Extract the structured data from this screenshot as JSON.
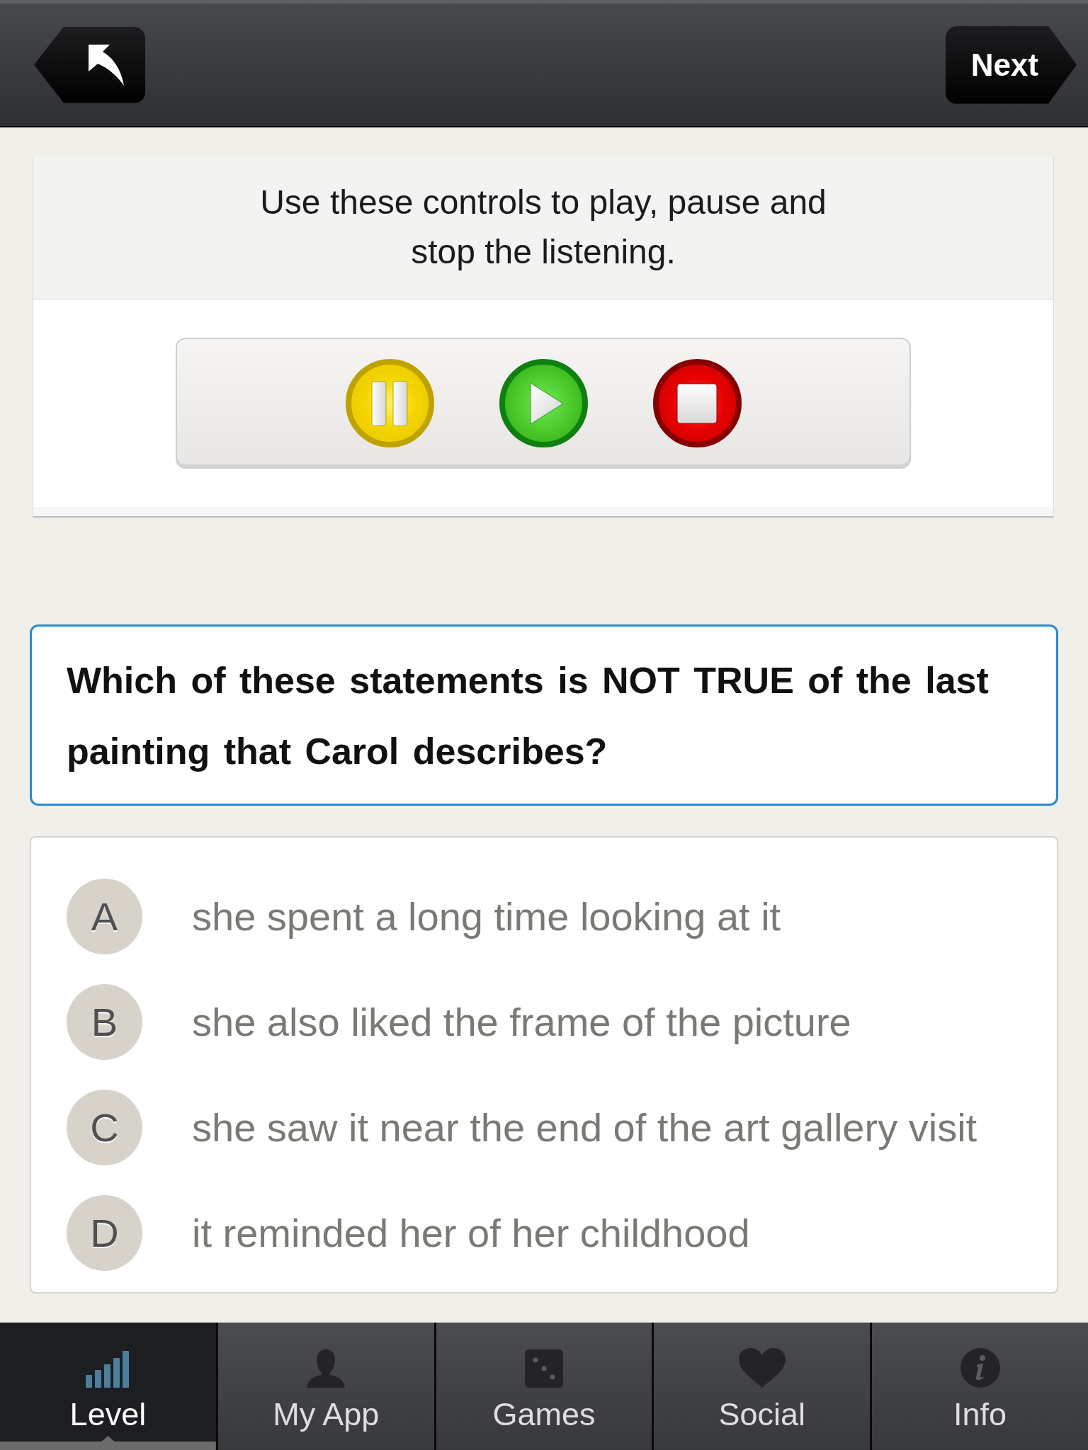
{
  "top_bar": {
    "next_button": "Next"
  },
  "instructions": {
    "text": "Use these controls to play, pause and stop the listening."
  },
  "player_controls": [
    {
      "kind": "pause"
    },
    {
      "kind": "play"
    },
    {
      "kind": "stop"
    }
  ],
  "question": {
    "text": "Which of these statements is NOT TRUE of the last painting that Carol describes?"
  },
  "options": [
    {
      "letter": "A",
      "text": "she spent a long time looking at it",
      "selected": false
    },
    {
      "letter": "B",
      "text": "she also liked the frame of the picture",
      "selected": false
    },
    {
      "letter": "C",
      "text": "she saw it near the end of the art gallery visit",
      "selected": false
    },
    {
      "letter": "D",
      "text": "it reminded her of her childhood",
      "selected": false
    }
  ],
  "tab_bar": [
    {
      "kind": "level",
      "label": "Level",
      "selected": true
    },
    {
      "kind": "profile",
      "label": "My App",
      "selected": false
    },
    {
      "kind": "games",
      "label": "Games",
      "selected": false
    },
    {
      "kind": "social",
      "label": "Social",
      "selected": false
    },
    {
      "kind": "info",
      "label": "Info",
      "selected": false
    }
  ]
}
